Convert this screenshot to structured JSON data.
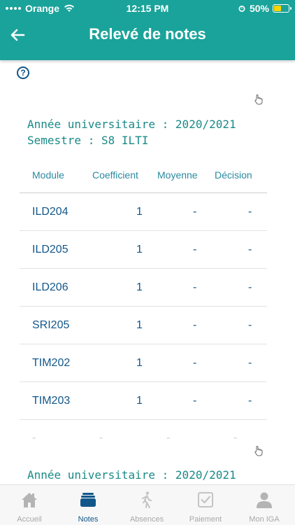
{
  "status_bar": {
    "carrier": "Orange",
    "time": "12:15 PM",
    "battery": "50%",
    "battery_level": 0.5
  },
  "header": {
    "title": "Relevé de notes",
    "back_icon": "arrow-left-icon"
  },
  "sections": [
    {
      "year_label": "Année universitaire : 2020/2021",
      "semester_label": "Semestre : S8 ILTI"
    },
    {
      "year_label": "Année universitaire : 2020/2021"
    }
  ],
  "table": {
    "headers": [
      "Module",
      "Coefficient",
      "Moyenne",
      "Décision"
    ],
    "rows": [
      [
        "ILD204",
        "1",
        "-",
        "-"
      ],
      [
        "ILD205",
        "1",
        "-",
        "-"
      ],
      [
        "ILD206",
        "1",
        "-",
        "-"
      ],
      [
        "SRI205",
        "1",
        "-",
        "-"
      ],
      [
        "TIM202",
        "1",
        "-",
        "-"
      ],
      [
        "TIM203",
        "1",
        "-",
        "-"
      ]
    ],
    "faded_row": [
      "-",
      "-",
      "-",
      "-"
    ]
  },
  "tabs": [
    {
      "label": "Accueil",
      "icon": "home-icon",
      "active": false
    },
    {
      "label": "Notes",
      "icon": "notes-stack-icon",
      "active": true
    },
    {
      "label": "Absences",
      "icon": "walking-person-icon",
      "active": false
    },
    {
      "label": "Paiement",
      "icon": "checkbox-icon",
      "active": false
    },
    {
      "label": "Mon IGA",
      "icon": "person-icon",
      "active": false
    }
  ],
  "colors": {
    "header": "#1aa39a",
    "primary_text": "#12578a",
    "section_text": "#1a8a87",
    "tab_inactive": "#a8a8a8"
  }
}
